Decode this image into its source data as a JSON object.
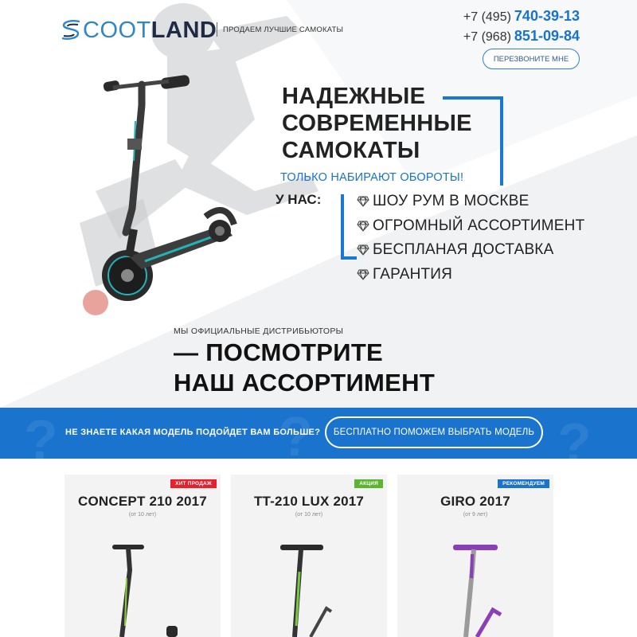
{
  "header": {
    "logo_scoot": "COOT",
    "logo_land": "LAND",
    "tagline": "ПРОДАЕМ ЛУЧШИЕ САМОКАТЫ",
    "phone1_prefix": "+7 (495)",
    "phone1_number": "740-39-13",
    "phone2_prefix": "+7 (968)",
    "phone2_number": "851-09-84",
    "callback_label": "ПЕРЕЗВОНИТЕ МНЕ"
  },
  "hero": {
    "headline_line1": "НАДЕЖНЫЕ",
    "headline_line2": "СОВРЕМЕННЫЕ",
    "headline_line3": "САМОКАТЫ",
    "subhead": "ТОЛЬКО НАБИРАЮТ ОБОРОТЫ!",
    "u_nas": "У НАС:",
    "features": [
      "ШОУ РУМ В МОСКВЕ",
      "ОГРОМНЫЙ АССОРТИМЕНТ",
      "БЕСПЛАНАЯ ДОСТАВКА",
      "ГАРАНТИЯ"
    ]
  },
  "distributors": {
    "small": "МЫ ОФИЦИАЛЬНЫЕ ДИСТРИБЬЮТОРЫ",
    "big_line1": "— ПОСМОТРИТЕ",
    "big_line2": "НАШ АССОРТИМЕНТ"
  },
  "banner": {
    "text": "НЕ ЗНАЕТЕ КАКАЯ МОДЕЛЬ ПОДОЙДЕТ ВАМ БОЛЬШЕ?",
    "button_label": "БЕСПЛАТНО ПОМОЖЕМ ВЫБРАТЬ МОДЕЛЬ",
    "color": "#1a73cc"
  },
  "products": [
    {
      "title": "CONCEPT 210 2017",
      "age": "(от 10 лет)",
      "badge": "ХИТ ПРОДАЖ",
      "badge_color": "#e8202e",
      "accent": "#8fd13a"
    },
    {
      "title": "TT-210 LUX 2017",
      "age": "(от 10 лет)",
      "badge": "АКЦИЯ",
      "badge_color": "#5bb531",
      "accent": "#7ac943"
    },
    {
      "title": "GIRO 2017",
      "age": "(от 9 лет)",
      "badge": "РЕКОМЕНДУЕМ",
      "badge_color": "#1a73cc",
      "accent": "#8a3fb8"
    }
  ],
  "colors": {
    "accent_blue": "#1b78d0",
    "headline": "#222222"
  }
}
